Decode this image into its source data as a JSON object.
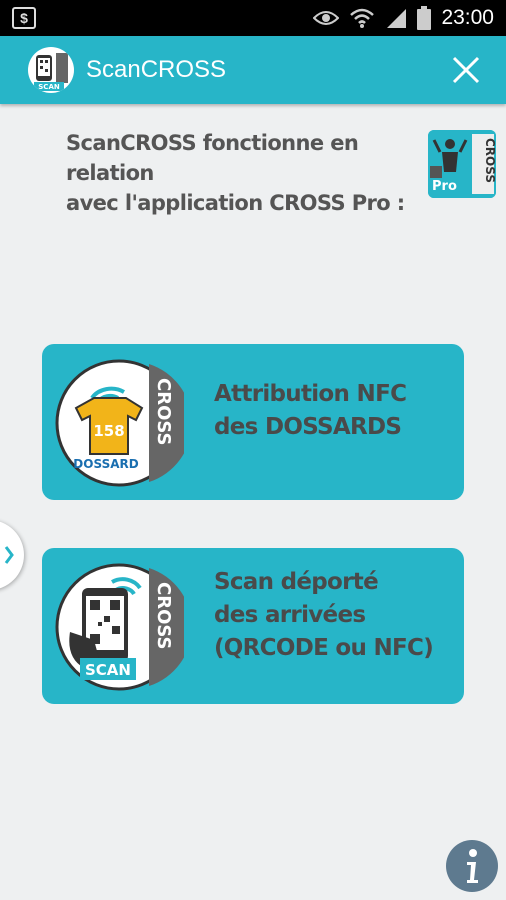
{
  "status_bar": {
    "time": "23:00",
    "left_icon": "dollar-notification-icon",
    "icons": [
      "eye-icon",
      "wifi-icon",
      "signal-icon",
      "battery-icon"
    ]
  },
  "app_bar": {
    "title": "ScanCROSS",
    "icon": "scancross-app-icon",
    "close_icon": "close-icon",
    "icon_text": "SCAN"
  },
  "intro": {
    "line1": "ScanCROSS fonctionne en relation",
    "line2": "avec l'application CROSS Pro :",
    "logo_text_pro": "Pro",
    "logo_text_cross": "CROSS"
  },
  "cards": [
    {
      "line1": "Attribution NFC",
      "line2": "des DOSSARDS",
      "badge_number": "158",
      "badge_label": "DOSSARD",
      "side_label": "CROSS"
    },
    {
      "line1": "Scan déporté",
      "line2": "des arrivées",
      "line3": "(QRCODE ou NFC)",
      "badge_label": "SCAN",
      "side_label": "CROSS"
    }
  ],
  "colors": {
    "accent": "#27b5c8",
    "background": "#eef0f1",
    "text": "#4a4a4a",
    "info": "#5e7a8f"
  }
}
